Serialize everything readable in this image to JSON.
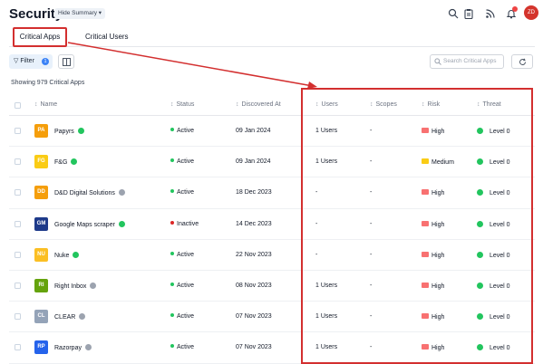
{
  "header": {
    "title": "Security",
    "hide_summary": "Hide Summary ▾",
    "avatar_initials": "ZD",
    "icons": [
      "search-icon",
      "clipboard-icon",
      "rss-icon",
      "bell-icon"
    ]
  },
  "tabs": [
    {
      "label": "Critical Apps",
      "active": true
    },
    {
      "label": "Critical Users",
      "active": false
    }
  ],
  "toolbar": {
    "filter_label": "Filter",
    "filter_count": "1",
    "search_placeholder": "Search Critical Apps"
  },
  "summary": {
    "showing": "Showing 979 Critical Apps"
  },
  "table": {
    "columns": {
      "name": "Name",
      "status": "Status",
      "discovered_at": "Discovered At",
      "users": "Users",
      "scopes": "Scopes",
      "risk": "Risk",
      "threat": "Threat"
    },
    "rows": [
      {
        "name": "Papyrs",
        "verified": true,
        "logo": "PA",
        "logo_color": "#f59e0b",
        "status": "Active",
        "discovered": "09 Jan 2024",
        "users": "1 Users",
        "scopes": "-",
        "risk": "High",
        "threat": "Level 0"
      },
      {
        "name": "F&G",
        "verified": true,
        "logo": "FG",
        "logo_color": "#facc15",
        "status": "Active",
        "discovered": "09 Jan 2024",
        "users": "1 Users",
        "scopes": "-",
        "risk": "Medium",
        "threat": "Level 0"
      },
      {
        "name": "D&D Digital Solutions",
        "verified": false,
        "logo": "DD",
        "logo_color": "#f59e0b",
        "status": "Active",
        "discovered": "18 Dec 2023",
        "users": "-",
        "scopes": "-",
        "risk": "High",
        "threat": "Level 0"
      },
      {
        "name": "Google Maps scraper",
        "verified": true,
        "logo": "GM",
        "logo_color": "#1e3a8a",
        "status": "Inactive",
        "discovered": "14 Dec 2023",
        "users": "-",
        "scopes": "-",
        "risk": "High",
        "threat": "Level 0"
      },
      {
        "name": "Nuke",
        "verified": true,
        "logo": "NU",
        "logo_color": "#fbbf24",
        "status": "Active",
        "discovered": "22 Nov 2023",
        "users": "-",
        "scopes": "-",
        "risk": "High",
        "threat": "Level 0"
      },
      {
        "name": "Right Inbox",
        "verified": false,
        "logo": "RI",
        "logo_color": "#65a30d",
        "status": "Active",
        "discovered": "08 Nov 2023",
        "users": "1 Users",
        "scopes": "-",
        "risk": "High",
        "threat": "Level 0"
      },
      {
        "name": "CLEAR",
        "verified": false,
        "logo": "CL",
        "logo_color": "#94a3b8",
        "status": "Active",
        "discovered": "07 Nov 2023",
        "users": "1 Users",
        "scopes": "-",
        "risk": "High",
        "threat": "Level 0"
      },
      {
        "name": "Razorpay",
        "verified": false,
        "logo": "RP",
        "logo_color": "#2563eb",
        "status": "Active",
        "discovered": "07 Nov 2023",
        "users": "1 Users",
        "scopes": "-",
        "risk": "High",
        "threat": "Level 0"
      }
    ]
  },
  "colors": {
    "active": "#22c55e",
    "inactive": "#dc2626",
    "risk_high": "#f87171",
    "risk_medium": "#facc15",
    "annotation": "#d32f2f"
  }
}
